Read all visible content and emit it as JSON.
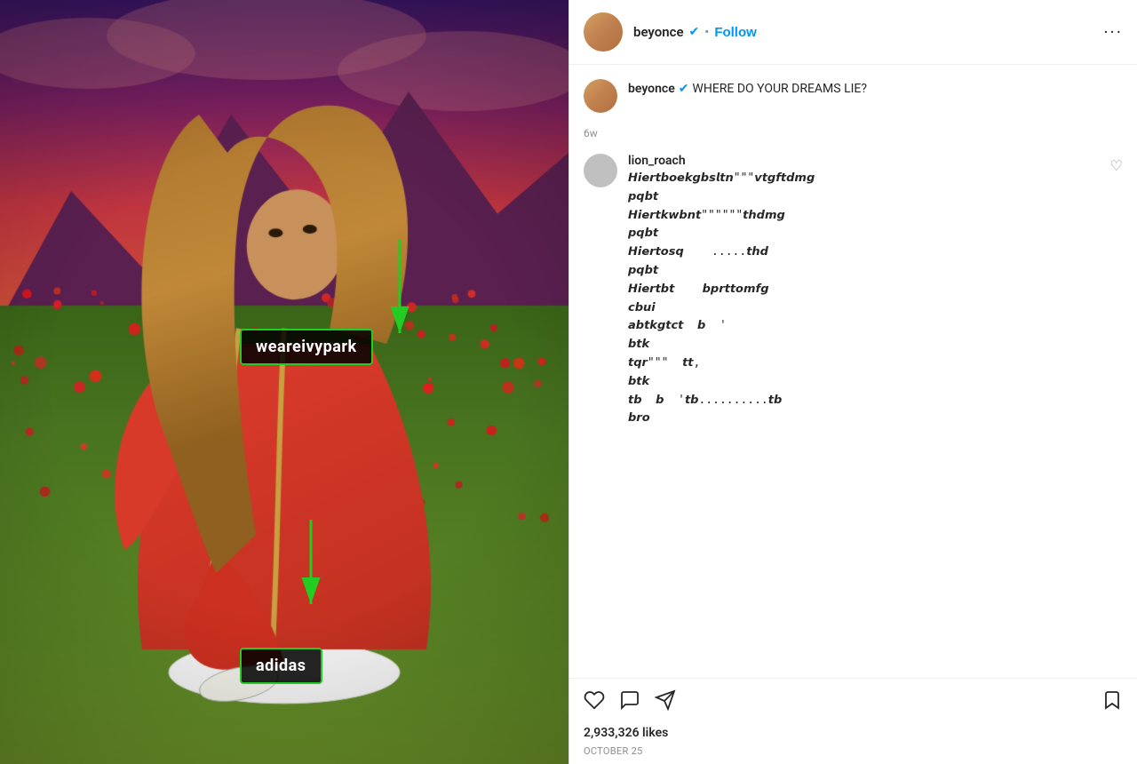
{
  "header": {
    "username": "beyonce",
    "verified": true,
    "follow_label": "Follow",
    "dot": "•",
    "more_label": "···"
  },
  "caption": {
    "username": "beyonce",
    "verified": true,
    "text": "WHERE DO YOUR DREAMS LIE?",
    "timestamp": "6w"
  },
  "comment": {
    "username": "lion_roach",
    "text": "𝙃𝙞𝙚𝙧𝙩𝙗𝙤𝙚𝙠𝙜𝙗𝙨𝙡𝙩𝙣\"\"\"𝙫𝙩𝙜𝙛𝙩𝙙𝙢𝙜\n𝙥𝙦𝙗𝙩\n𝙃𝙞𝙚𝙧𝙩𝙠𝙬𝙗𝙣𝙩\"\"\"\"\"\"𝙩𝙝𝙙𝙢𝙜\n𝙥𝙦𝙗𝙩\n𝙃𝙞𝙚𝙧𝙩𝙤𝙨𝙦    .....𝙩𝙝𝙙\n𝙥𝙦𝙗𝙩\n𝙃𝙞𝙚𝙧𝙩𝙗𝙩    𝙗𝙥𝙧𝙩𝙩𝙤𝙢𝙛𝙜\n𝙘𝙗𝙪𝙞\n𝙖𝙗𝙩𝙠𝙜𝙩𝙘𝙩  𝙗  '\n𝙗𝙩𝙠\n𝙩𝙦𝙧\"\"\"  𝙩𝙩,\n𝙗𝙩𝙠\n𝙩𝙗  𝙗  '𝙩𝙗..........𝙩𝙗\n𝙗𝙧𝙤",
    "heart": "♡"
  },
  "actions": {
    "like_label": "♡",
    "comment_label": "💬",
    "share_label": "✈",
    "bookmark_label": "🔖",
    "likes_count": "2,933,326 likes",
    "date": "OCTOBER 25"
  },
  "annotations": [
    {
      "text": "weareivypark",
      "position": "upper"
    },
    {
      "text": "adidas",
      "position": "lower"
    }
  ]
}
